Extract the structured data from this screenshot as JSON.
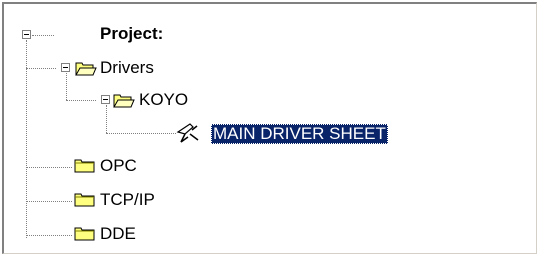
{
  "tree": {
    "root": {
      "label": "Project:"
    },
    "drivers": {
      "label": "Drivers"
    },
    "koyo": {
      "label": "KOYO"
    },
    "main_driver_sheet": {
      "label": "MAIN DRIVER SHEET",
      "selected": true
    },
    "opc": {
      "label": "OPC"
    },
    "tcpip": {
      "label": "TCP/IP"
    },
    "dde": {
      "label": "DDE"
    }
  },
  "colors": {
    "selection_bg": "#0a246a",
    "selection_fg": "#ffffff",
    "folder_yellow": "#ffff80",
    "folder_dark": "#808000"
  },
  "icons": {
    "folder": "folder-icon",
    "open_folder": "open-folder-icon",
    "driver": "driver-sheet-icon",
    "collapse": "collapse-icon"
  }
}
